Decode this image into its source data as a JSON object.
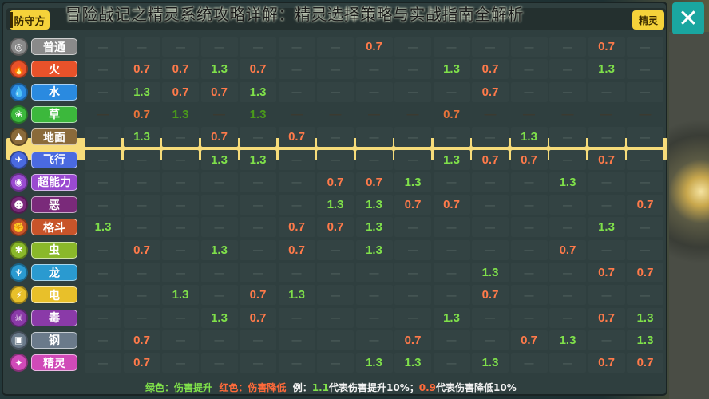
{
  "title": "冒险战记之精灵系统攻略详解：精灵选择策略与实战指南全解析",
  "corner_label": "防守方",
  "right_header": "精灵",
  "legend": {
    "green_label": "绿色：伤害提升",
    "red_label": "红色：伤害降低",
    "example_prefix": "例：",
    "up_value": "1.1",
    "up_text": "代表伤害提升10%；",
    "down_value": "0.9",
    "down_text": "代表伤害降低10%"
  },
  "colors": {
    "up": "#7fe04a",
    "down": "#ff7a4a",
    "highlight_row": "#f7dc7a",
    "header_yellow": "#f5d23a",
    "close_button": "#1aa6a0"
  },
  "empty_mark": "—",
  "types": [
    {
      "name": "普通",
      "color": "#8a8a8a",
      "icon": "◎",
      "icon_name": "normal-icon"
    },
    {
      "name": "火",
      "color": "#e8522a",
      "icon": "🔥",
      "icon_name": "fire-icon"
    },
    {
      "name": "水",
      "color": "#2a8ae0",
      "icon": "💧",
      "icon_name": "water-icon"
    },
    {
      "name": "草",
      "color": "#3cb83c",
      "icon": "❀",
      "icon_name": "grass-icon"
    },
    {
      "name": "地面",
      "color": "#8a6a3a",
      "icon": "⛰",
      "icon_name": "ground-icon"
    },
    {
      "name": "飞行",
      "color": "#4a6ae0",
      "icon": "✈",
      "icon_name": "flying-icon"
    },
    {
      "name": "超能力",
      "color": "#9a4ad0",
      "icon": "◉",
      "icon_name": "psychic-icon"
    },
    {
      "name": "恶",
      "color": "#7a2a7a",
      "icon": "☻",
      "icon_name": "dark-icon"
    },
    {
      "name": "格斗",
      "color": "#c8542a",
      "icon": "✊",
      "icon_name": "fighting-icon"
    },
    {
      "name": "虫",
      "color": "#8ab82a",
      "icon": "✱",
      "icon_name": "bug-icon"
    },
    {
      "name": "龙",
      "color": "#2a9ad0",
      "icon": "♆",
      "icon_name": "dragon-icon"
    },
    {
      "name": "电",
      "color": "#e8c02a",
      "icon": "⚡",
      "icon_name": "electric-icon"
    },
    {
      "name": "毒",
      "color": "#8a3aa8",
      "icon": "☠",
      "icon_name": "poison-icon"
    },
    {
      "name": "钢",
      "color": "#6a7a8a",
      "icon": "▣",
      "icon_name": "steel-icon"
    },
    {
      "name": "精灵",
      "color": "#d04ab8",
      "icon": "✦",
      "icon_name": "fairy-icon"
    }
  ],
  "matrix": [
    [
      "",
      "",
      "",
      "",
      "",
      "",
      "",
      "0.7",
      "",
      "",
      "",
      "",
      "",
      "0.7",
      ""
    ],
    [
      "",
      "0.7",
      "0.7",
      "1.3",
      "0.7",
      "",
      "",
      "",
      "",
      "1.3",
      "0.7",
      "",
      "",
      "1.3",
      ""
    ],
    [
      "",
      "1.3",
      "0.7",
      "0.7",
      "1.3",
      "",
      "",
      "",
      "",
      "",
      "0.7",
      "",
      "",
      "",
      ""
    ],
    [
      "—",
      "0.7",
      "1.3",
      "—",
      "1.3",
      "—",
      "—",
      "—",
      "—",
      "0.7",
      "—",
      "—",
      "—",
      "—",
      "—"
    ],
    [
      "",
      "1.3",
      "",
      "0.7",
      "",
      "0.7",
      "",
      "",
      "",
      "",
      "",
      "1.3",
      "",
      "",
      ""
    ],
    [
      "",
      "",
      "",
      "1.3",
      "1.3",
      "",
      "",
      "",
      "",
      "1.3",
      "0.7",
      "0.7",
      "",
      "0.7",
      ""
    ],
    [
      "",
      "",
      "",
      "",
      "",
      "",
      "0.7",
      "0.7",
      "1.3",
      "",
      "",
      "",
      "1.3",
      "",
      ""
    ],
    [
      "",
      "",
      "",
      "",
      "",
      "",
      "1.3",
      "1.3",
      "0.7",
      "0.7",
      "",
      "",
      "",
      "",
      "0.7"
    ],
    [
      "1.3",
      "",
      "",
      "",
      "",
      "0.7",
      "0.7",
      "1.3",
      "",
      "",
      "",
      "",
      "",
      "1.3",
      ""
    ],
    [
      "",
      "0.7",
      "",
      "1.3",
      "",
      "0.7",
      "",
      "1.3",
      "",
      "",
      "",
      "",
      "0.7",
      "",
      ""
    ],
    [
      "",
      "",
      "",
      "",
      "",
      "",
      "",
      "",
      "",
      "",
      "1.3",
      "",
      "",
      "0.7",
      "0.7"
    ],
    [
      "",
      "",
      "1.3",
      "",
      "0.7",
      "1.3",
      "",
      "",
      "",
      "",
      "0.7",
      "",
      "",
      "",
      ""
    ],
    [
      "",
      "",
      "",
      "1.3",
      "0.7",
      "",
      "",
      "",
      "",
      "1.3",
      "",
      "",
      "",
      "0.7",
      "1.3"
    ],
    [
      "",
      "0.7",
      "",
      "",
      "",
      "",
      "",
      "",
      "0.7",
      "",
      "",
      "0.7",
      "1.3",
      "",
      "1.3"
    ],
    [
      "",
      "0.7",
      "",
      "",
      "",
      "",
      "",
      "1.3",
      "1.3",
      "",
      "1.3",
      "",
      "",
      "0.7",
      "0.7"
    ]
  ]
}
